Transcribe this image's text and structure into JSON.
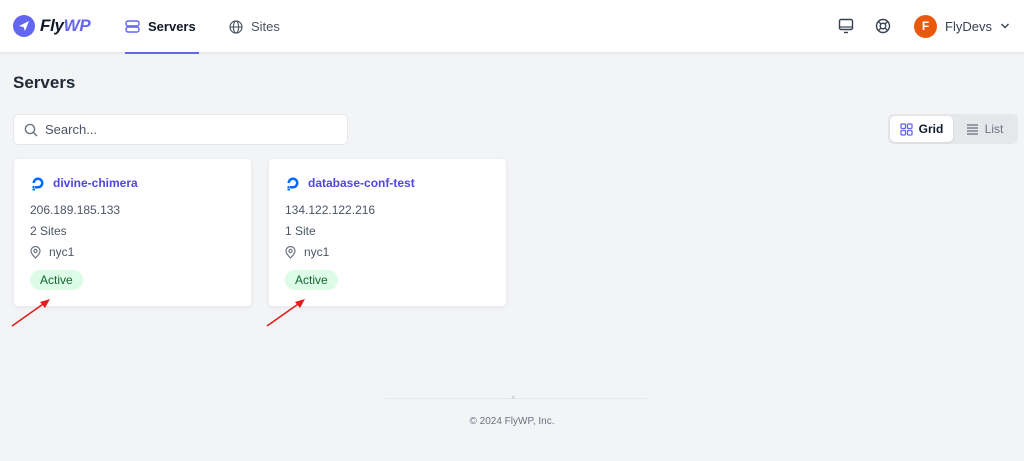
{
  "app": {
    "name_prefix": "Fly",
    "name_suffix": "WP",
    "brand_color": "#6366f1"
  },
  "nav": {
    "tabs": [
      {
        "label": "Servers",
        "icon": "server-icon",
        "active": true
      },
      {
        "label": "Sites",
        "icon": "globe-icon",
        "active": false
      }
    ],
    "right_icons": [
      "monitor-icon",
      "help-lifebuoy-icon"
    ],
    "user": {
      "initial": "F",
      "name": "FlyDevs"
    }
  },
  "page": {
    "title": "Servers"
  },
  "search": {
    "placeholder": "Search..."
  },
  "view_toggle": {
    "grid_label": "Grid",
    "list_label": "List",
    "selected": "Grid"
  },
  "servers": [
    {
      "name": "divine-chimera",
      "ip": "206.189.185.133",
      "sites": "2 Sites",
      "region": "nyc1",
      "status": "Active",
      "provider_icon": "digitalocean-icon"
    },
    {
      "name": "database-conf-test",
      "ip": "134.122.122.216",
      "sites": "1 Site",
      "region": "nyc1",
      "status": "Active",
      "provider_icon": "digitalocean-icon"
    }
  ],
  "footer": {
    "copyright": "© 2024 FlyWP, Inc."
  }
}
